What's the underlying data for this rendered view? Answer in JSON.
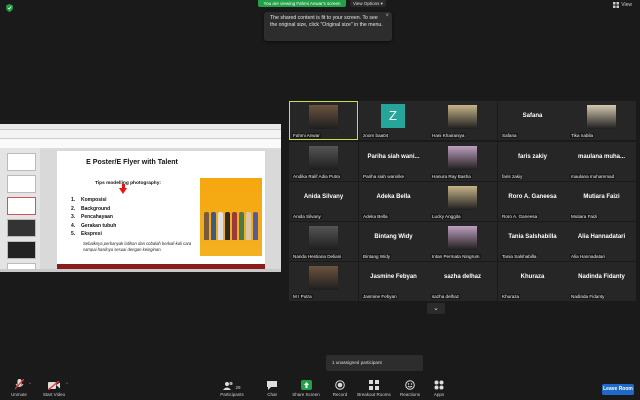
{
  "banner": {
    "viewing_text": "You are viewing Fahmi Anwar's screen",
    "view_options": "View Options ▾",
    "view_label": "View"
  },
  "tooltip": {
    "text": "The shared content is fit to your screen. To see the original size, click \"Original size\" in the menu.",
    "close": "×"
  },
  "slide": {
    "title": "E Poster/E Flyer with Talent",
    "subtitle": "Tips modelling photography:",
    "items": [
      {
        "num": "1.",
        "text": "Komposisi"
      },
      {
        "num": "2.",
        "text": "Background"
      },
      {
        "num": "3.",
        "text": "Pencahayaan"
      },
      {
        "num": "4.",
        "text": "Gerakan tubuh"
      },
      {
        "num": "5.",
        "text": "Ekspresi"
      }
    ],
    "note": "Sebaiknya perbanyak latihan dan cobalah berkali-kali cara sampai hasilnya sesuai dengan keinginan."
  },
  "participants_tiles": [
    {
      "name": "Fahmi Anwar",
      "big": "",
      "kind": "photo",
      "speaking": true
    },
    {
      "name": "zoom baa04",
      "big": "Z",
      "kind": "z"
    },
    {
      "name": "Hani Khairaniya",
      "big": "",
      "kind": "photo"
    },
    {
      "name": "Safana",
      "big": "Safana",
      "kind": "text"
    },
    {
      "name": "Tika nabila",
      "big": "",
      "kind": "photo"
    },
    {
      "name": "Andika Ralif Adia Putra",
      "big": "",
      "kind": "photo"
    },
    {
      "name": "Pariha siah wanirike",
      "big": "Pariha siah wani...",
      "kind": "text"
    },
    {
      "name": "Hanura Ray Basha",
      "big": "",
      "kind": "photo"
    },
    {
      "name": "faris zakiy",
      "big": "faris zakiy",
      "kind": "text"
    },
    {
      "name": "maulana muhammad",
      "big": "maulana muha...",
      "kind": "text"
    },
    {
      "name": "Anida Silvany",
      "big": "Anida Silvany",
      "kind": "text"
    },
    {
      "name": "Adeka Bella",
      "big": "Adeka Bella",
      "kind": "text"
    },
    {
      "name": "Lucky Anggita",
      "big": "",
      "kind": "photo"
    },
    {
      "name": "Roro A. Ganeesa",
      "big": "Roro A. Ganeesa",
      "kind": "text"
    },
    {
      "name": "Mutiara Faizi",
      "big": "Mutiara Faizi",
      "kind": "text"
    },
    {
      "name": "Nanda Hestiana Deliani",
      "big": "",
      "kind": "photo"
    },
    {
      "name": "Bintang Widy",
      "big": "Bintang Widy",
      "kind": "text"
    },
    {
      "name": "Intan Permata Ningrum",
      "big": "",
      "kind": "photo"
    },
    {
      "name": "Tania Salshabilla",
      "big": "Tania Salshabilla",
      "kind": "text"
    },
    {
      "name": "Alia Hannadatari",
      "big": "Alia Hannadatari",
      "kind": "text"
    },
    {
      "name": "M I Putra",
      "big": "",
      "kind": "photo"
    },
    {
      "name": "Jasmine Febyan",
      "big": "Jasmine Febyan",
      "kind": "text"
    },
    {
      "name": "sazha delhaz",
      "big": "sazha delhaz",
      "kind": "text"
    },
    {
      "name": "Khuraza",
      "big": "Khuraza",
      "kind": "text"
    },
    {
      "name": "Nadinda Fidanty",
      "big": "Nadinda Fidanty",
      "kind": "text"
    }
  ],
  "gallery_next": "⌄",
  "unassigned": "1 unassigned participant",
  "toolbar": {
    "unmute": "Unmute",
    "start_video": "Start Video",
    "participants": "Participants",
    "participants_count": "29",
    "chat": "Chat",
    "share_screen": "Share Screen",
    "record": "Record",
    "breakout": "Breakout Rooms",
    "reactions": "Reactions",
    "apps": "Apps",
    "leave": "Leave Room"
  },
  "colors": {
    "accent_green": "#23a047",
    "speaking_border": "#c6e04a",
    "leave_blue": "#1f6ac9",
    "zoom_tile": "#26a69a"
  }
}
